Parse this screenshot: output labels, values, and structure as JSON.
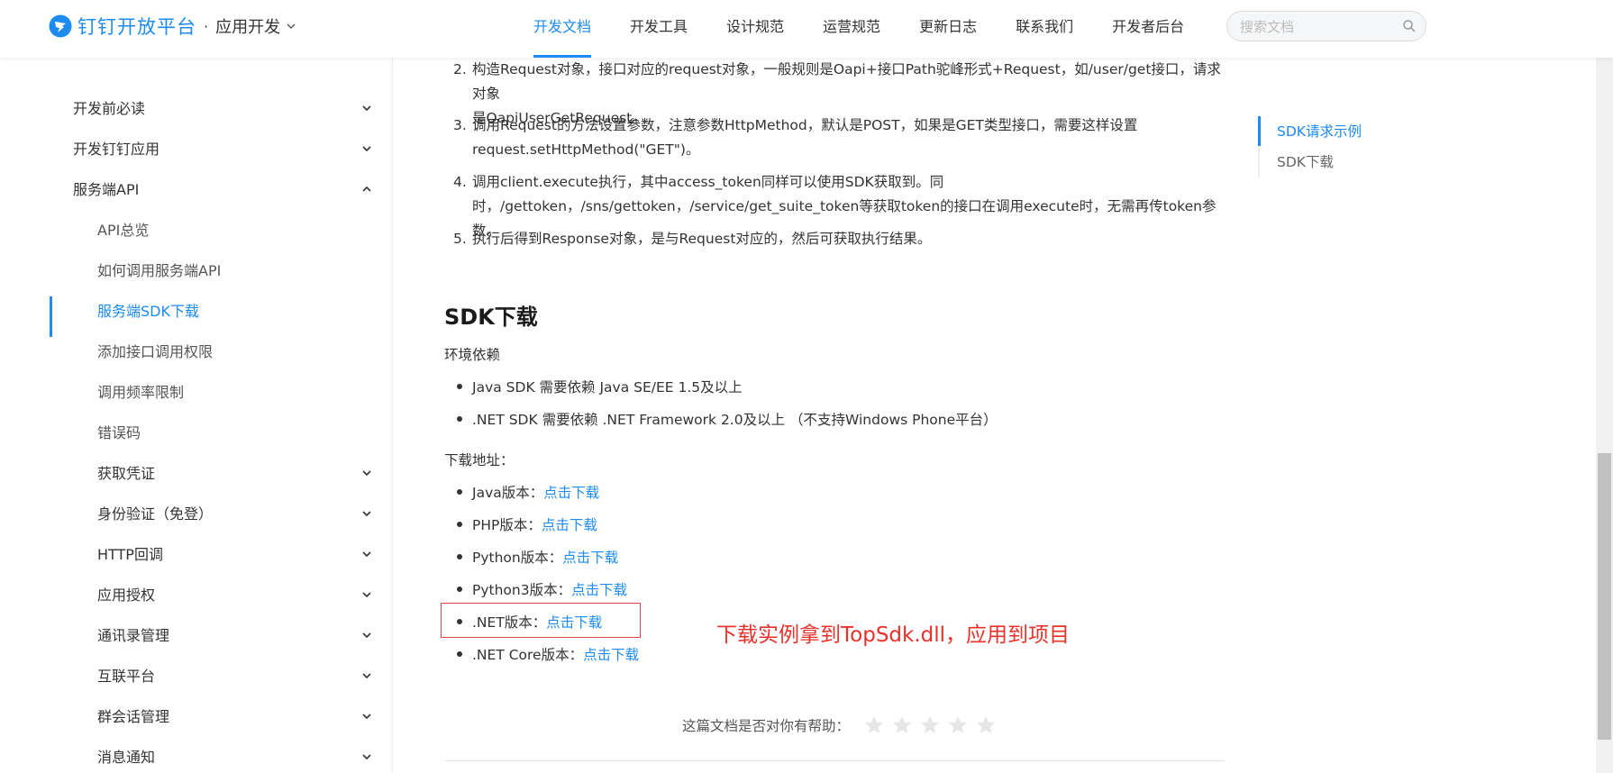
{
  "header": {
    "brand": "钉钉开放平台",
    "separator": "·",
    "section": "应用开发",
    "nav": [
      "开发文档",
      "开发工具",
      "设计规范",
      "运营规范",
      "更新日志",
      "联系我们",
      "开发者后台"
    ],
    "active_nav": "开发文档",
    "search_placeholder": "搜索文档"
  },
  "sidebar": {
    "items": [
      {
        "label": "开发前必读",
        "level": 1,
        "chevron": "down"
      },
      {
        "label": "开发钉钉应用",
        "level": 1,
        "chevron": "down"
      },
      {
        "label": "服务端API",
        "level": 1,
        "chevron": "up"
      },
      {
        "label": "API总览",
        "level": 2
      },
      {
        "label": "如何调用服务端API",
        "level": 2
      },
      {
        "label": "服务端SDK下载",
        "level": 2,
        "active": true
      },
      {
        "label": "添加接口调用权限",
        "level": 2
      },
      {
        "label": "调用频率限制",
        "level": 2
      },
      {
        "label": "错误码",
        "level": 2
      },
      {
        "label": "获取凭证",
        "level": 2,
        "chevron": "down"
      },
      {
        "label": "身份验证（免登）",
        "level": 2,
        "chevron": "down"
      },
      {
        "label": "HTTP回调",
        "level": 2,
        "chevron": "down"
      },
      {
        "label": "应用授权",
        "level": 2,
        "chevron": "down"
      },
      {
        "label": "通讯录管理",
        "level": 2,
        "chevron": "down"
      },
      {
        "label": "互联平台",
        "level": 2,
        "chevron": "down"
      },
      {
        "label": "群会话管理",
        "level": 2,
        "chevron": "down"
      },
      {
        "label": "消息通知",
        "level": 2,
        "chevron": "down"
      }
    ]
  },
  "content": {
    "steps": [
      {
        "num": "2.",
        "lines": [
          "构造Request对象，接口对应的request对象，一般规则是Oapi+接口Path驼峰形式+Request，如/user/get接口，请求对象",
          "是OapiUserGetRequest。"
        ]
      },
      {
        "num": "3.",
        "lines": [
          "调用Request的方法设置参数，注意参数HttpMethod，默认是POST，如果是GET类型接口，需要这样设置",
          "request.setHttpMethod(\"GET\")。"
        ]
      },
      {
        "num": "4.",
        "lines": [
          "调用client.execute执行，其中access_token同样可以使用SDK获取到。同",
          "时，/gettoken，/sns/gettoken，/service/get_suite_token等获取token的接口在调用execute时，无需再传token参数。"
        ]
      },
      {
        "num": "5.",
        "lines": [
          "执行后得到Response对象，是与Request对应的，然后可获取执行结果。"
        ]
      }
    ],
    "sdk_heading": "SDK下载",
    "env_label": "环境依赖",
    "env_items": [
      "Java SDK 需要依赖 Java SE/EE 1.5及以上",
      ".NET SDK 需要依赖 .NET Framework 2.0及以上 （不支持Windows Phone平台）"
    ],
    "download_label": "下载地址：",
    "downloads": [
      {
        "label": "Java版本：",
        "link": "点击下载"
      },
      {
        "label": "PHP版本：",
        "link": "点击下载"
      },
      {
        "label": "Python版本：",
        "link": "点击下载"
      },
      {
        "label": "Python3版本：",
        "link": "点击下载"
      },
      {
        "label": ".NET版本：",
        "link": "点击下载"
      },
      {
        "label": ".NET Core版本：",
        "link": "点击下载"
      }
    ],
    "annotation": "下载实例拿到TopSdk.dll，应用到项目",
    "feedback_question": "这篇文档是否对你有帮助："
  },
  "toc": {
    "items": [
      "SDK请求示例",
      "SDK下载"
    ],
    "active": "SDK请求示例"
  },
  "colors": {
    "accent": "#1d8bf0",
    "annotation": "#e8312a"
  }
}
